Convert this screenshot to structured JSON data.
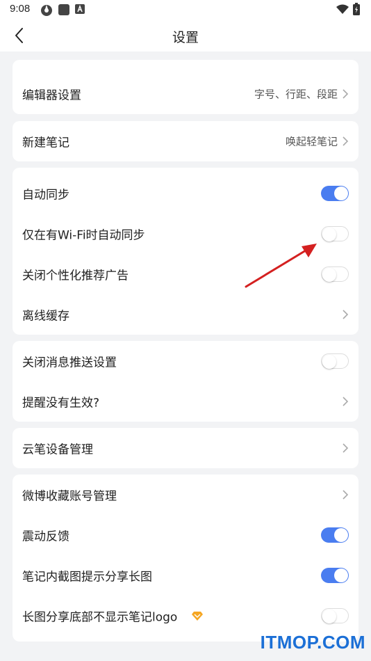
{
  "status_bar": {
    "time": "9:08"
  },
  "header": {
    "title": "设置"
  },
  "cards": {
    "editor": {
      "label": "编辑器设置",
      "value": "字号、行距、段距"
    },
    "new_note": {
      "label": "新建笔记",
      "value": "唤起轻笔记"
    },
    "sync": {
      "auto_sync": {
        "label": "自动同步",
        "on": true
      },
      "wifi_only": {
        "label": "仅在有Wi-Fi时自动同步",
        "on": false
      },
      "ads": {
        "label": "关闭个性化推荐广告",
        "on": false
      },
      "offline": {
        "label": "离线缓存"
      }
    },
    "push": {
      "close_push": {
        "label": "关闭消息推送设置",
        "on": false
      },
      "reminder": {
        "label": "提醒没有生效?"
      }
    },
    "device": {
      "label": "云笔设备管理"
    },
    "misc": {
      "weibo": {
        "label": "微博收藏账号管理"
      },
      "vibration": {
        "label": "震动反馈",
        "on": true
      },
      "screenshot": {
        "label": "笔记内截图提示分享长图",
        "on": true
      },
      "long_img": {
        "label": "长图分享底部不显示笔记logo",
        "on": false
      }
    }
  },
  "watermark": "ITMOP.COM",
  "colors": {
    "accent": "#4a7df0",
    "background": "#f2f3f5",
    "arrow": "#d42020"
  }
}
